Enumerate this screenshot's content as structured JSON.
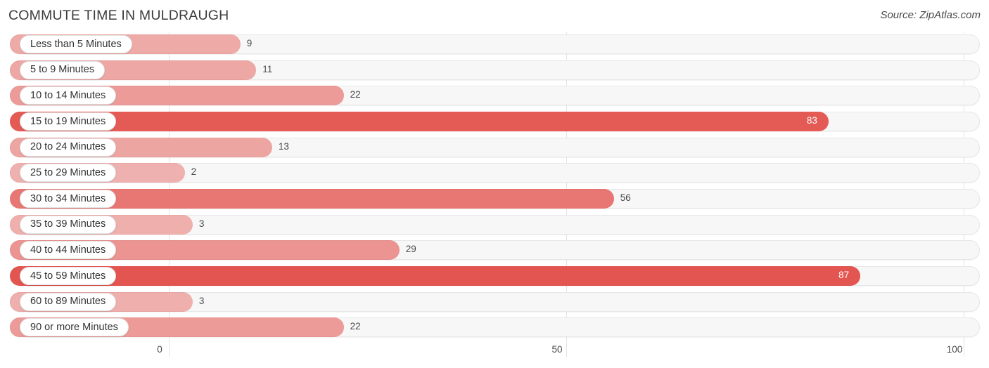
{
  "header": {
    "title": "COMMUTE TIME IN MULDRAUGH",
    "source": "Source: ZipAtlas.com"
  },
  "colors": {
    "bar_strong": "#E8706B",
    "bar_light": "#F2ABA8",
    "track": "#F7F7F7",
    "gridline": "#E3E3E3",
    "label_pill": "#FFFFFF",
    "text": "#3B3B3B"
  },
  "chart_data": {
    "type": "bar",
    "orientation": "horizontal",
    "title": "COMMUTE TIME IN MULDRAUGH",
    "xlabel": "",
    "ylabel": "",
    "xlim": [
      0,
      100
    ],
    "xticks": [
      0,
      50,
      100
    ],
    "xtick_labels": [
      "0",
      "50",
      "100"
    ],
    "grid": true,
    "legend": false,
    "categories": [
      "Less than 5 Minutes",
      "5 to 9 Minutes",
      "10 to 14 Minutes",
      "15 to 19 Minutes",
      "20 to 24 Minutes",
      "25 to 29 Minutes",
      "30 to 34 Minutes",
      "35 to 39 Minutes",
      "40 to 44 Minutes",
      "45 to 59 Minutes",
      "60 to 89 Minutes",
      "90 or more Minutes"
    ],
    "values": [
      9,
      11,
      22,
      83,
      13,
      2,
      56,
      3,
      29,
      87,
      3,
      22
    ],
    "value_labels": [
      "9",
      "11",
      "22",
      "83",
      "13",
      "2",
      "56",
      "3",
      "29",
      "87",
      "3",
      "22"
    ]
  },
  "rows": [
    {
      "label": "Less than 5 Minutes",
      "value": 9,
      "value_label": "9",
      "inside": false
    },
    {
      "label": "5 to 9 Minutes",
      "value": 11,
      "value_label": "11",
      "inside": false
    },
    {
      "label": "10 to 14 Minutes",
      "value": 22,
      "value_label": "22",
      "inside": false
    },
    {
      "label": "15 to 19 Minutes",
      "value": 83,
      "value_label": "83",
      "inside": true
    },
    {
      "label": "20 to 24 Minutes",
      "value": 13,
      "value_label": "13",
      "inside": false
    },
    {
      "label": "25 to 29 Minutes",
      "value": 2,
      "value_label": "2",
      "inside": false
    },
    {
      "label": "30 to 34 Minutes",
      "value": 56,
      "value_label": "56",
      "inside": false
    },
    {
      "label": "35 to 39 Minutes",
      "value": 3,
      "value_label": "3",
      "inside": false
    },
    {
      "label": "40 to 44 Minutes",
      "value": 29,
      "value_label": "29",
      "inside": false
    },
    {
      "label": "45 to 59 Minutes",
      "value": 87,
      "value_label": "87",
      "inside": true
    },
    {
      "label": "60 to 89 Minutes",
      "value": 3,
      "value_label": "3",
      "inside": false
    },
    {
      "label": "90 or more Minutes",
      "value": 22,
      "value_label": "22",
      "inside": false
    }
  ],
  "axis": {
    "ticks": [
      {
        "label": "0",
        "value": 0
      },
      {
        "label": "50",
        "value": 50
      },
      {
        "label": "100",
        "value": 100
      }
    ]
  }
}
